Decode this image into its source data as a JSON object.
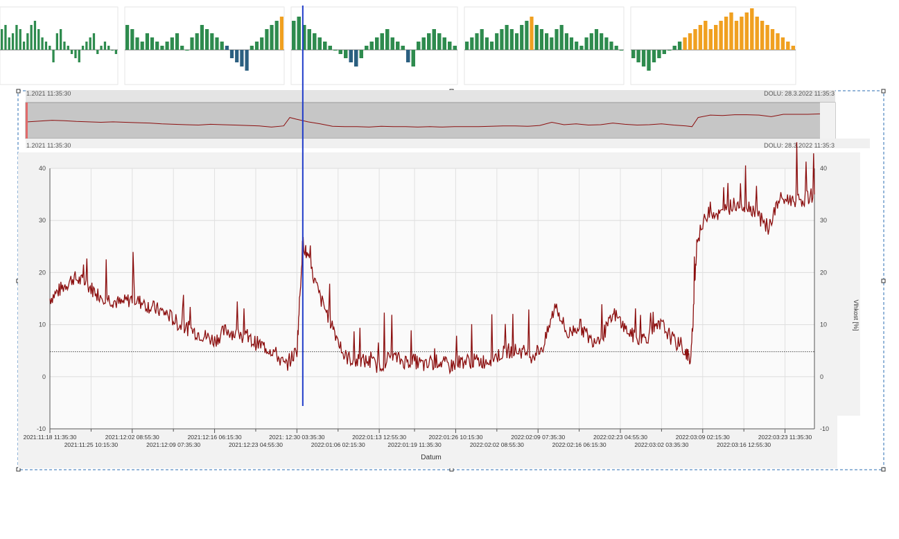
{
  "overview": {
    "start_label": "1.2021 11:35:30",
    "end_label": "DOLU: 28.3.2022 11:35:3",
    "top_left_label": "1.2021 11:35:30",
    "top_right_label": "DOLU: 28.3.2022 11:35:3"
  },
  "chart_data": {
    "type": "line",
    "title": "",
    "xlabel": "Datum",
    "ylabel_right": "Vlhkost [%]",
    "ylim": [
      -10,
      40
    ],
    "yticks": [
      -10,
      0,
      10,
      20,
      30,
      40
    ],
    "reference_line": 4.8,
    "grid": true,
    "series_color": "#8b0e0e",
    "cursor_color": "#1f3bc9",
    "cursor_date": "2021-12-31",
    "xticks_upper": [
      "2021:11:18 11:35:30",
      "2021:12:02 08:55:30",
      "2021:12:16 06:15:30",
      "2021: 12:30 03:35:30",
      "2022:01:13 12:55:30",
      "2022:01:26 10:15:30",
      "2022:02:09 07:35:30",
      "2022:02:23 04:55:30",
      "2022:03:09 02:15:30",
      "2022:03:23 11:35:30"
    ],
    "xticks_lower": [
      "2021:11:25 10:15:30",
      "2021:12:09 07:35:30",
      "2021:12:23 04:55:30",
      "2022:01:06 02:15:30",
      "2022:01:19 11:35:30",
      "2022:02:02 08:55:30",
      "2022:02:16 06:15:30",
      "2022:03:02 03:35:30",
      "2022:03:16 12:55:30"
    ],
    "date_ticks_upper": [
      "2021-11-18",
      "2021-12-02",
      "2021-12-16",
      "2021-12-30",
      "2022-01-13",
      "2022-01-26",
      "2022-02-09",
      "2022-02-23",
      "2022-03-09",
      "2022-03-23"
    ],
    "date_ticks_lower": [
      "2021-11-25",
      "2021-12-09",
      "2021-12-23",
      "2022-01-06",
      "2022-01-19",
      "2022-02-02",
      "2022-02-16",
      "2022-03-02",
      "2022-03-16"
    ],
    "x": [
      "2021-11-18",
      "2021-11-20",
      "2021-11-22",
      "2021-11-24",
      "2021-11-26",
      "2021-11-28",
      "2021-11-30",
      "2021-12-02",
      "2021-12-04",
      "2021-12-06",
      "2021-12-08",
      "2021-12-10",
      "2021-12-12",
      "2021-12-14",
      "2021-12-16",
      "2021-12-18",
      "2021-12-20",
      "2021-12-22",
      "2021-12-24",
      "2021-12-26",
      "2021-12-28",
      "2021-12-30",
      "2021-12-31",
      "2022-01-01",
      "2022-01-03",
      "2022-01-05",
      "2022-01-07",
      "2022-01-09",
      "2022-01-11",
      "2022-01-13",
      "2022-01-15",
      "2022-01-17",
      "2022-01-19",
      "2022-01-21",
      "2022-01-23",
      "2022-01-25",
      "2022-01-27",
      "2022-01-29",
      "2022-01-31",
      "2022-02-02",
      "2022-02-04",
      "2022-02-06",
      "2022-02-08",
      "2022-02-10",
      "2022-02-12",
      "2022-02-14",
      "2022-02-16",
      "2022-02-18",
      "2022-02-20",
      "2022-02-22",
      "2022-02-24",
      "2022-02-26",
      "2022-02-28",
      "2022-03-02",
      "2022-03-04",
      "2022-03-06",
      "2022-03-07",
      "2022-03-08",
      "2022-03-10",
      "2022-03-12",
      "2022-03-14",
      "2022-03-16",
      "2022-03-18",
      "2022-03-20",
      "2022-03-22",
      "2022-03-24",
      "2022-03-26",
      "2022-03-28"
    ],
    "y": [
      15,
      17,
      19,
      18,
      16,
      15,
      14,
      15,
      14,
      13,
      12,
      10,
      9,
      8,
      7,
      9,
      8,
      7,
      6,
      5,
      2,
      5,
      26,
      22,
      15,
      10,
      4,
      3,
      3,
      2,
      4,
      3,
      3,
      2,
      3,
      2,
      3,
      3,
      3,
      4,
      5,
      5,
      4,
      6,
      14,
      8,
      10,
      7,
      8,
      12,
      9,
      7,
      8,
      10,
      7,
      5,
      3,
      26,
      32,
      31,
      33,
      33,
      32,
      28,
      34,
      34,
      34,
      35
    ]
  },
  "mini_charts": [
    {
      "name": "panel-1",
      "values": [
        5,
        6,
        3,
        4,
        6,
        5,
        2,
        4,
        6,
        7,
        5,
        3,
        2,
        1,
        -3,
        4,
        5,
        2,
        1,
        -1,
        -2,
        -3,
        1,
        2,
        3,
        4,
        -1,
        1,
        2,
        1,
        0,
        -1
      ]
    },
    {
      "name": "panel-2",
      "values": [
        6,
        5,
        3,
        2,
        4,
        3,
        2,
        1,
        2,
        3,
        4,
        1,
        0,
        3,
        4,
        6,
        5,
        4,
        3,
        2,
        1,
        -2,
        -3,
        -4,
        -5,
        1,
        2,
        3,
        5,
        6,
        7,
        8
      ]
    },
    {
      "name": "panel-3",
      "values": [
        7,
        8,
        6,
        5,
        4,
        3,
        2,
        1,
        0,
        -1,
        -2,
        -3,
        -4,
        -2,
        1,
        2,
        3,
        4,
        5,
        3,
        2,
        1,
        -3,
        -4,
        2,
        3,
        4,
        5,
        4,
        3,
        2,
        1
      ]
    },
    {
      "name": "panel-4",
      "values": [
        2,
        3,
        4,
        5,
        3,
        2,
        4,
        5,
        6,
        5,
        4,
        6,
        7,
        8,
        6,
        5,
        4,
        3,
        5,
        6,
        4,
        3,
        2,
        1,
        3,
        4,
        5,
        4,
        3,
        2,
        1,
        0
      ]
    },
    {
      "name": "panel-5",
      "values": [
        -2,
        -3,
        -4,
        -5,
        -3,
        -2,
        -1,
        0,
        1,
        2,
        3,
        4,
        5,
        6,
        7,
        5,
        6,
        7,
        8,
        9,
        7,
        8,
        9,
        10,
        8,
        7,
        6,
        5,
        4,
        3,
        2,
        1
      ]
    }
  ]
}
